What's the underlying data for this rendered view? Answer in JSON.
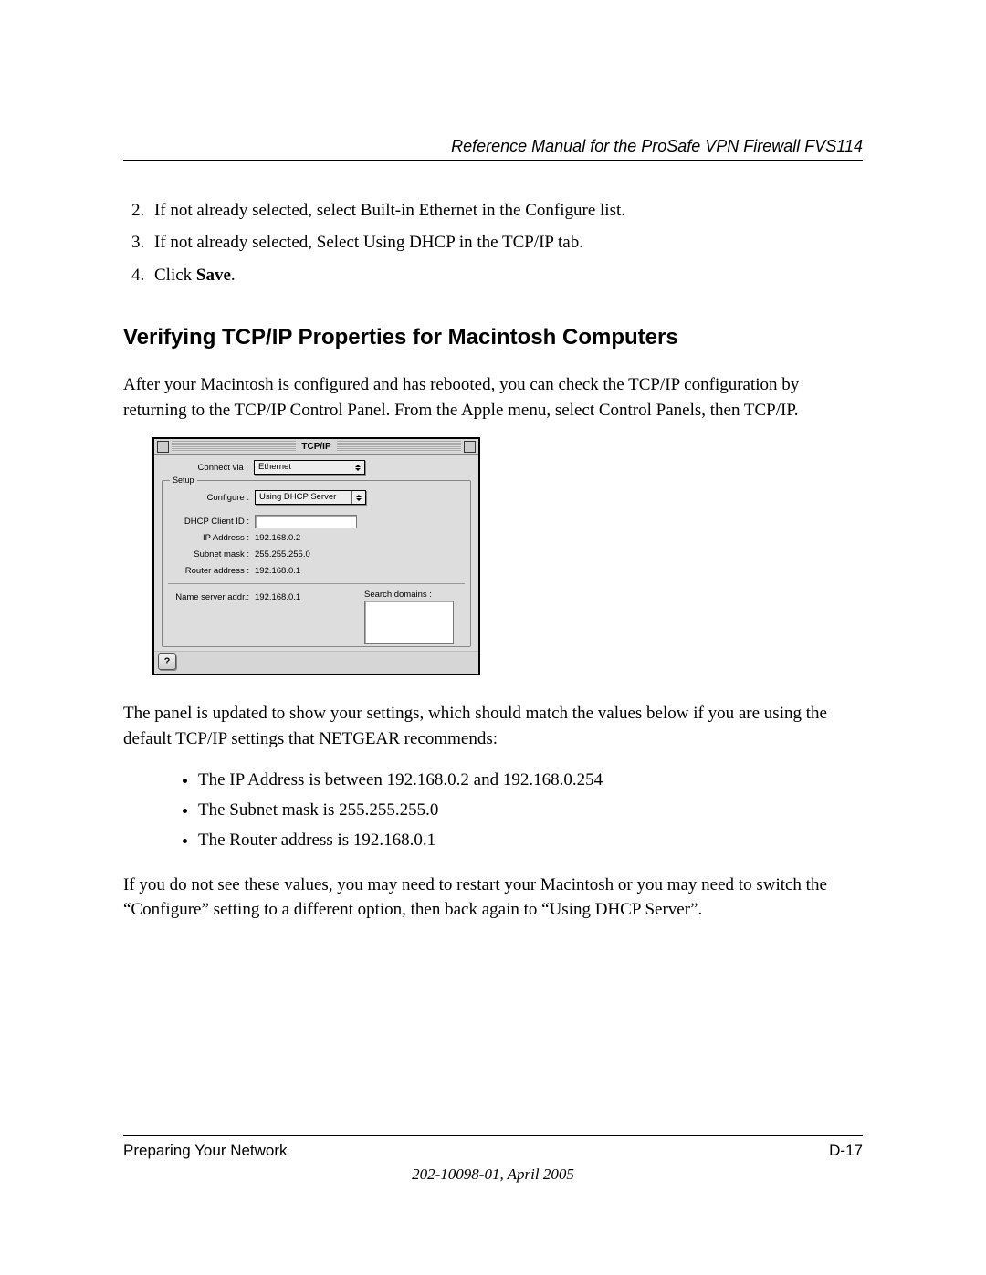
{
  "header": {
    "running_title": "Reference Manual for the ProSafe VPN Firewall FVS114"
  },
  "steps": {
    "s2": "If not already selected, select Built-in Ethernet in the Configure list.",
    "s3": "If not already selected, Select Using DHCP in the TCP/IP tab.",
    "s4_prefix": "Click ",
    "s4_bold": "Save",
    "s4_suffix": "."
  },
  "heading": "Verifying TCP/IP Properties for Macintosh Computers",
  "para1": "After your Macintosh is configured and has rebooted, you can check the TCP/IP configuration by returning to the TCP/IP Control Panel. From the Apple menu, select Control Panels, then TCP/IP.",
  "panel": {
    "title": "TCP/IP",
    "labels": {
      "connect_via": "Connect via :",
      "setup": "Setup",
      "configure": "Configure :",
      "dhcp_client_id": "DHCP Client ID :",
      "ip_address": "IP Address :",
      "subnet_mask": "Subnet mask :",
      "router_address": "Router address :",
      "name_server": "Name server addr.:",
      "search_domains": "Search domains :"
    },
    "values": {
      "connect_via": "Ethernet",
      "configure": "Using DHCP Server",
      "dhcp_client_id": "",
      "ip_address": "192.168.0.2",
      "subnet_mask": "255.255.255.0",
      "router_address": "192.168.0.1",
      "name_server": "192.168.0.1"
    },
    "help_glyph": "?"
  },
  "para2": "The panel is updated to show your settings, which should match the values below if you are using the default TCP/IP settings that NETGEAR recommends:",
  "bullets": {
    "b1": "The IP Address is between 192.168.0.2 and 192.168.0.254",
    "b2": "The Subnet mask is 255.255.255.0",
    "b3": "The Router address is 192.168.0.1"
  },
  "para3": "If you do not see these values, you may need to restart your Macintosh or you may need to switch the “Configure” setting to a different option, then back again to “Using DHCP Server”.",
  "footer": {
    "section": "Preparing Your Network",
    "pagenum": "D-17",
    "docnum": "202-10098-01, April 2005"
  }
}
